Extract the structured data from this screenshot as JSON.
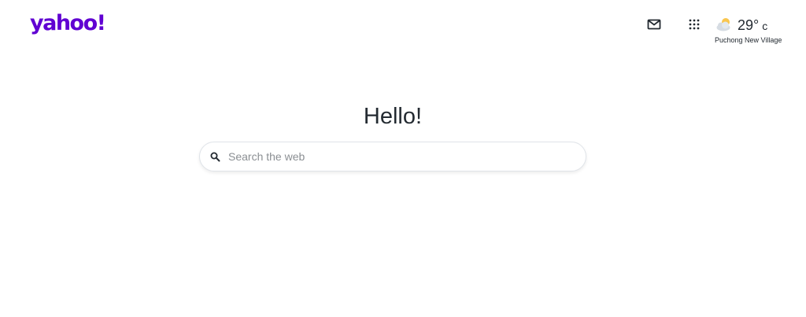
{
  "header": {
    "logo_text": "yahoo!",
    "logo_color": "#6001d2",
    "mail_icon": "mail-icon",
    "apps_icon": "apps-grid-icon",
    "weather": {
      "icon": "partly-cloudy-icon",
      "temperature": "29°",
      "unit": "c",
      "location": "Puchong New Village"
    }
  },
  "main": {
    "greeting": "Hello!",
    "search": {
      "placeholder": "Search the web",
      "value": ""
    }
  },
  "colors": {
    "text": "#232a31",
    "placeholder": "#8b8f93",
    "border": "#e0e4e9"
  }
}
